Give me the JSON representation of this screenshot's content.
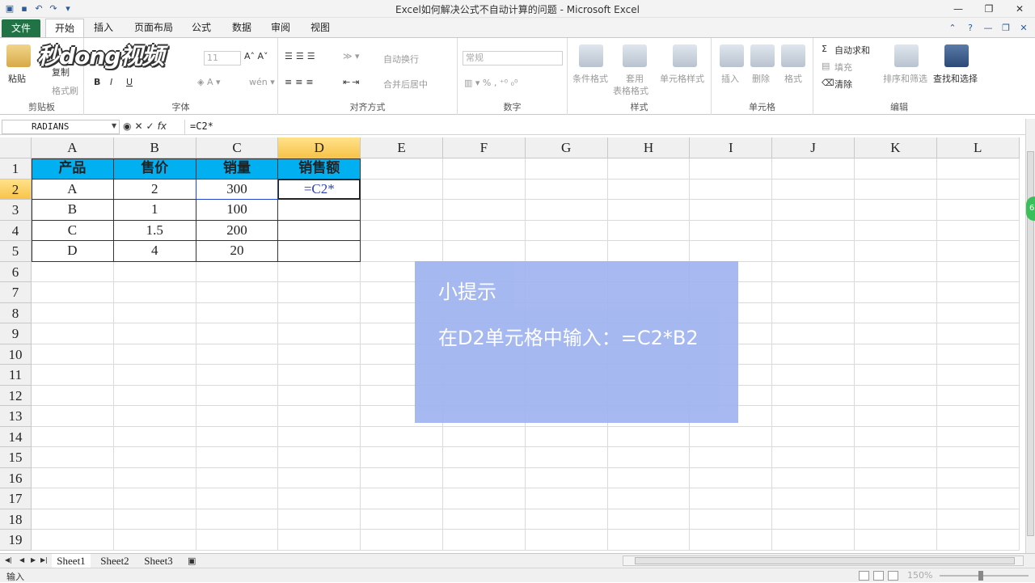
{
  "window": {
    "title": "Excel如何解决公式不自动计算的问题 - Microsoft Excel"
  },
  "tabs": [
    "文件",
    "开始",
    "插入",
    "页面布局",
    "公式",
    "数据",
    "审阅",
    "视图"
  ],
  "ribbon": {
    "clipboard": {
      "paste": "粘贴",
      "copy": "复制",
      "format_painter": "格式刷",
      "label": "剪贴板"
    },
    "font": {
      "size": "11",
      "label": "字体"
    },
    "alignment": {
      "wrap": "自动换行",
      "merge": "合并后居中",
      "label": "对齐方式"
    },
    "number": {
      "format": "常规",
      "label": "数字"
    },
    "styles": {
      "cond": "条件格式",
      "table1": "套用",
      "table2": "表格格式",
      "cell": "单元格样式",
      "label": "样式"
    },
    "cells": {
      "insert": "插入",
      "delete": "删除",
      "format": "格式",
      "label": "单元格"
    },
    "editing": {
      "autosum": "自动求和",
      "fill": "填充",
      "clear": "清除",
      "sort": "排序和筛选",
      "find": "查找和选择",
      "label": "编辑"
    }
  },
  "logo": "秒dong视频",
  "formula_bar": {
    "name_box": "RADIANS",
    "formula": "=C2*"
  },
  "columns": [
    "A",
    "B",
    "C",
    "D",
    "E",
    "F",
    "G",
    "H",
    "I",
    "J",
    "K",
    "L"
  ],
  "rows": [
    "1",
    "2",
    "3",
    "4",
    "5",
    "6",
    "7",
    "8",
    "9",
    "10",
    "11",
    "12",
    "13",
    "14",
    "15",
    "16",
    "17",
    "18",
    "19"
  ],
  "table": {
    "headers": [
      "产品",
      "售价",
      "销量",
      "销售额"
    ],
    "data": [
      [
        "A",
        "2",
        "300",
        "=C2*"
      ],
      [
        "B",
        "1",
        "100",
        ""
      ],
      [
        "C",
        "1.5",
        "200",
        ""
      ],
      [
        "D",
        "4",
        "20",
        ""
      ]
    ]
  },
  "tip": {
    "title": "小提示",
    "body": "在D2单元格中输入：=C2*B2"
  },
  "sheets": [
    "Sheet1",
    "Sheet2",
    "Sheet3"
  ],
  "status": {
    "mode": "输入",
    "zoom": "150%"
  },
  "side_badge": "6"
}
